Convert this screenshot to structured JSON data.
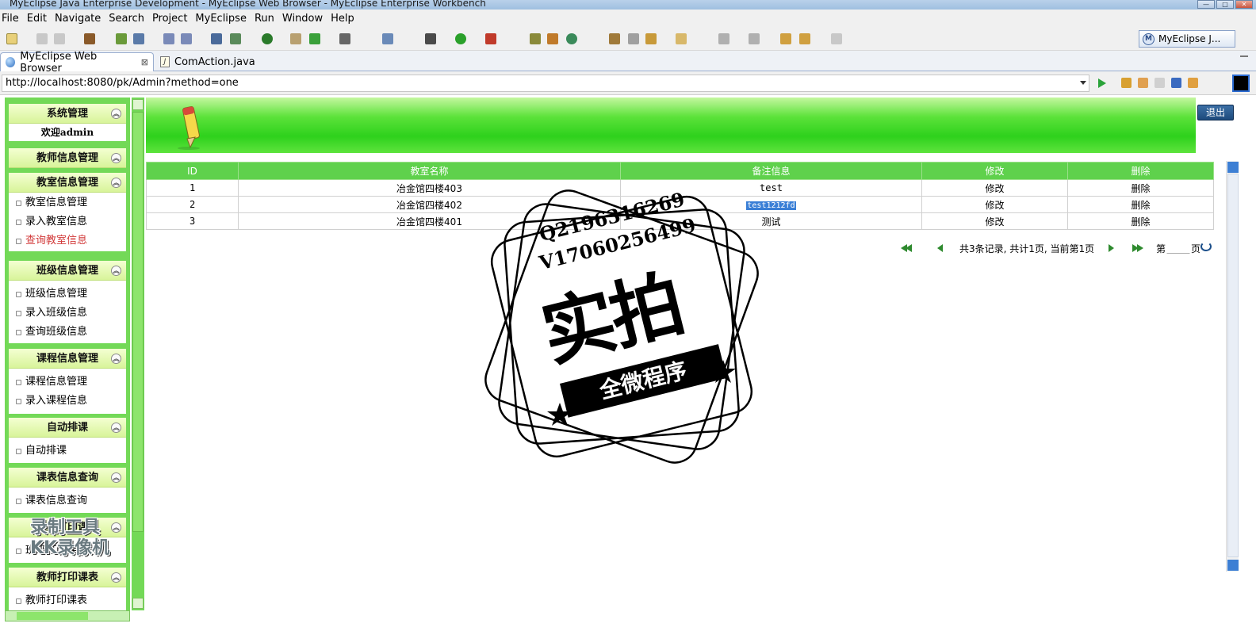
{
  "window": {
    "title": "MyEclipse Java Enterprise Development - MyEclipse Web Browser - MyEclipse Enterprise Workbench",
    "controls": [
      "—",
      "□",
      "✕"
    ]
  },
  "menu": [
    "File",
    "Edit",
    "Navigate",
    "Search",
    "Project",
    "MyEclipse",
    "Run",
    "Window",
    "Help"
  ],
  "perspective": {
    "label": "MyEclipse J...",
    "badge": "M"
  },
  "tabs": [
    {
      "label": "MyEclipse Web Browser",
      "close": "⊠",
      "active": true
    },
    {
      "label": "ComAction.java",
      "badge": "J",
      "active": false
    }
  ],
  "address": {
    "url": "http://localhost:8080/pk/Admin?method=one"
  },
  "sidebar": {
    "sections": [
      {
        "title": "系统管理",
        "welcome": "欢迎admin",
        "items": []
      },
      {
        "title": "教师信息管理",
        "items": []
      },
      {
        "title": "教室信息管理",
        "items": [
          "教室信息管理",
          "录入教室信息",
          "查询教室信息"
        ]
      },
      {
        "title": "班级信息管理",
        "items": [
          "班级信息管理",
          "录入班级信息",
          "查询班级信息"
        ]
      },
      {
        "title": "课程信息管理",
        "items": [
          "课程信息管理",
          "录入课程信息"
        ]
      },
      {
        "title": "自动排课",
        "items": [
          "自动排课"
        ]
      },
      {
        "title": "课表信息查询",
        "items": [
          "课表信息查询"
        ]
      },
      {
        "title": "班级打印课表",
        "items": [
          "班级打印课表"
        ]
      },
      {
        "title": "教师打印课表",
        "items": [
          "教师打印课表"
        ]
      }
    ],
    "collapse_glyph": "︽"
  },
  "header": {
    "logout": "退出"
  },
  "table": {
    "columns": [
      "ID",
      "教室名称",
      "备注信息",
      "修改",
      "删除"
    ],
    "rows": [
      {
        "id": "1",
        "name": "冶金馆四楼403",
        "note": "test",
        "edit": "修改",
        "delete": "删除"
      },
      {
        "id": "2",
        "name": "冶金馆四楼402",
        "note": "test1212fd",
        "edit": "修改",
        "delete": "删除"
      },
      {
        "id": "3",
        "name": "冶金馆四楼401",
        "note": "测试",
        "edit": "修改",
        "delete": "删除"
      }
    ]
  },
  "pager": {
    "info": "共3条记录, 共计1页, 当前第1页",
    "page_prefix": "第",
    "page_suffix": "页",
    "page_value": ""
  },
  "watermark": {
    "qq": "Q2196316269",
    "wx": "V17060256499",
    "big": "实拍",
    "ribbon": "全微程序",
    "tool_line1": "录制工具",
    "tool_line2": "KK录像机"
  },
  "colors": {
    "sidebar_green": "#73d957",
    "header_green": "#2ed11c",
    "table_header": "#5fd14c",
    "selection_blue": "#3a7fd6"
  }
}
